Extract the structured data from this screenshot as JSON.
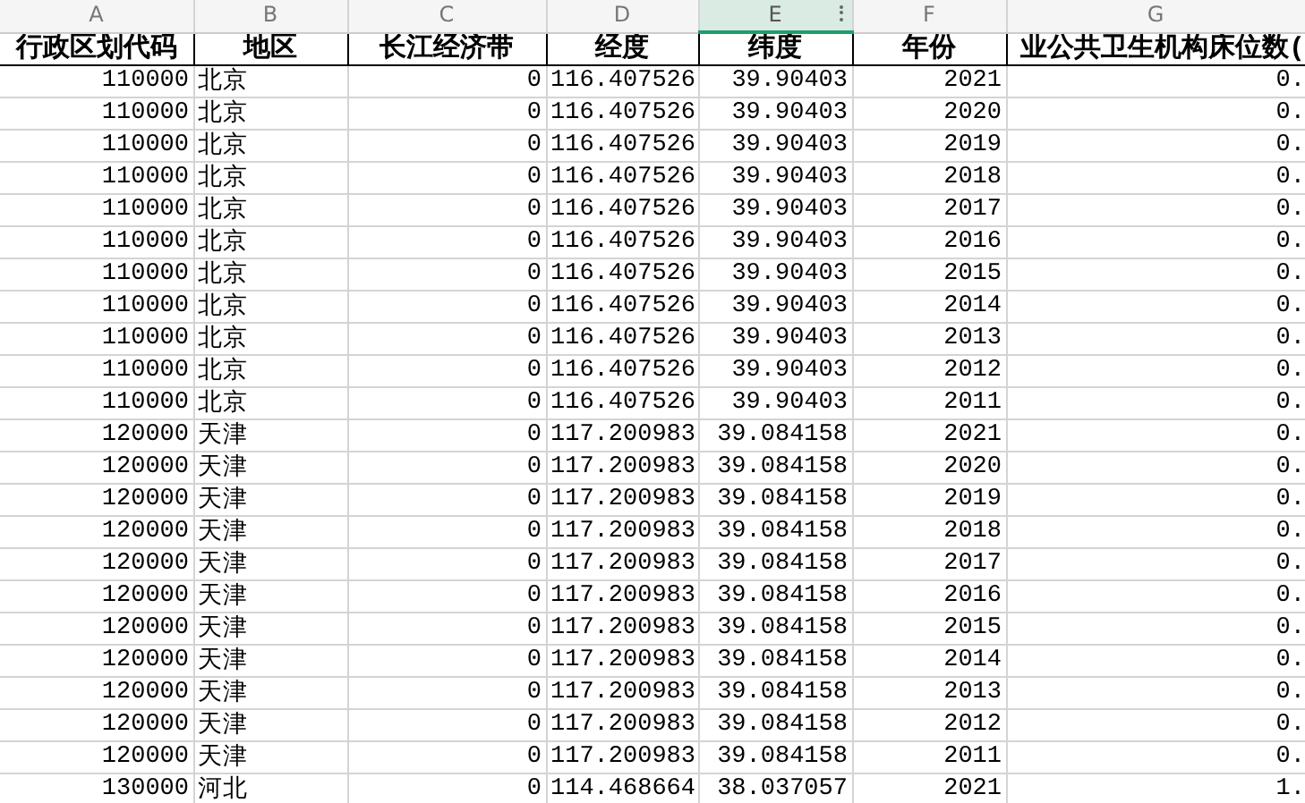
{
  "columns": [
    {
      "letter": "A",
      "header": "行政区划代码",
      "selected": false
    },
    {
      "letter": "B",
      "header": "地区",
      "selected": false
    },
    {
      "letter": "C",
      "header": "长江经济带",
      "selected": false
    },
    {
      "letter": "D",
      "header": "经度",
      "selected": false
    },
    {
      "letter": "E",
      "header": "纬度",
      "selected": true
    },
    {
      "letter": "F",
      "header": "年份",
      "selected": false
    },
    {
      "letter": "G",
      "header": "业公共卫生机构床位数(",
      "selected": false
    }
  ],
  "rows": [
    [
      "110000",
      "北京",
      "0",
      "116.407526",
      "39.90403",
      "2021",
      "0."
    ],
    [
      "110000",
      "北京",
      "0",
      "116.407526",
      "39.90403",
      "2020",
      "0."
    ],
    [
      "110000",
      "北京",
      "0",
      "116.407526",
      "39.90403",
      "2019",
      "0."
    ],
    [
      "110000",
      "北京",
      "0",
      "116.407526",
      "39.90403",
      "2018",
      "0."
    ],
    [
      "110000",
      "北京",
      "0",
      "116.407526",
      "39.90403",
      "2017",
      "0."
    ],
    [
      "110000",
      "北京",
      "0",
      "116.407526",
      "39.90403",
      "2016",
      "0."
    ],
    [
      "110000",
      "北京",
      "0",
      "116.407526",
      "39.90403",
      "2015",
      "0."
    ],
    [
      "110000",
      "北京",
      "0",
      "116.407526",
      "39.90403",
      "2014",
      "0."
    ],
    [
      "110000",
      "北京",
      "0",
      "116.407526",
      "39.90403",
      "2013",
      "0."
    ],
    [
      "110000",
      "北京",
      "0",
      "116.407526",
      "39.90403",
      "2012",
      "0."
    ],
    [
      "110000",
      "北京",
      "0",
      "116.407526",
      "39.90403",
      "2011",
      "0."
    ],
    [
      "120000",
      "天津",
      "0",
      "117.200983",
      "39.084158",
      "2021",
      "0."
    ],
    [
      "120000",
      "天津",
      "0",
      "117.200983",
      "39.084158",
      "2020",
      "0."
    ],
    [
      "120000",
      "天津",
      "0",
      "117.200983",
      "39.084158",
      "2019",
      "0."
    ],
    [
      "120000",
      "天津",
      "0",
      "117.200983",
      "39.084158",
      "2018",
      "0."
    ],
    [
      "120000",
      "天津",
      "0",
      "117.200983",
      "39.084158",
      "2017",
      "0."
    ],
    [
      "120000",
      "天津",
      "0",
      "117.200983",
      "39.084158",
      "2016",
      "0."
    ],
    [
      "120000",
      "天津",
      "0",
      "117.200983",
      "39.084158",
      "2015",
      "0."
    ],
    [
      "120000",
      "天津",
      "0",
      "117.200983",
      "39.084158",
      "2014",
      "0."
    ],
    [
      "120000",
      "天津",
      "0",
      "117.200983",
      "39.084158",
      "2013",
      "0."
    ],
    [
      "120000",
      "天津",
      "0",
      "117.200983",
      "39.084158",
      "2012",
      "0."
    ],
    [
      "120000",
      "天津",
      "0",
      "117.200983",
      "39.084158",
      "2011",
      "0."
    ],
    [
      "130000",
      "河北",
      "0",
      "114.468664",
      "38.037057",
      "2021",
      "1."
    ]
  ]
}
